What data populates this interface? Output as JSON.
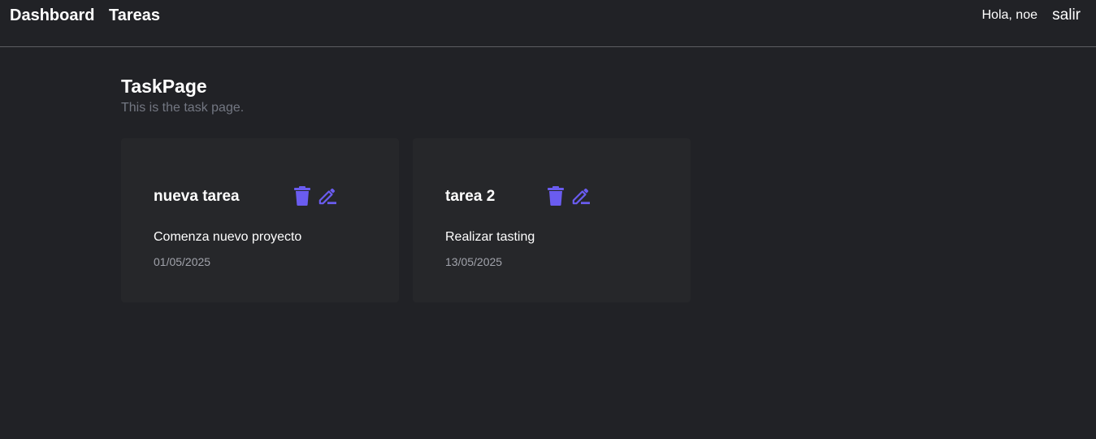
{
  "nav": {
    "links": [
      "Dashboard",
      "Tareas"
    ],
    "greeting": "Hola, noe",
    "logout_label": "salir"
  },
  "page": {
    "title": "TaskPage",
    "subtitle": "This is the task page."
  },
  "accent_color": "#6a5cf0",
  "tasks": [
    {
      "title": "nueva tarea",
      "description": "Comenza nuevo proyecto",
      "date": "01/05/2025",
      "icons": [
        "trash-icon",
        "edit-icon"
      ]
    },
    {
      "title": "tarea 2",
      "description": "Realizar tasting",
      "date": "13/05/2025",
      "icons": [
        "trash-icon",
        "edit-icon"
      ]
    }
  ]
}
